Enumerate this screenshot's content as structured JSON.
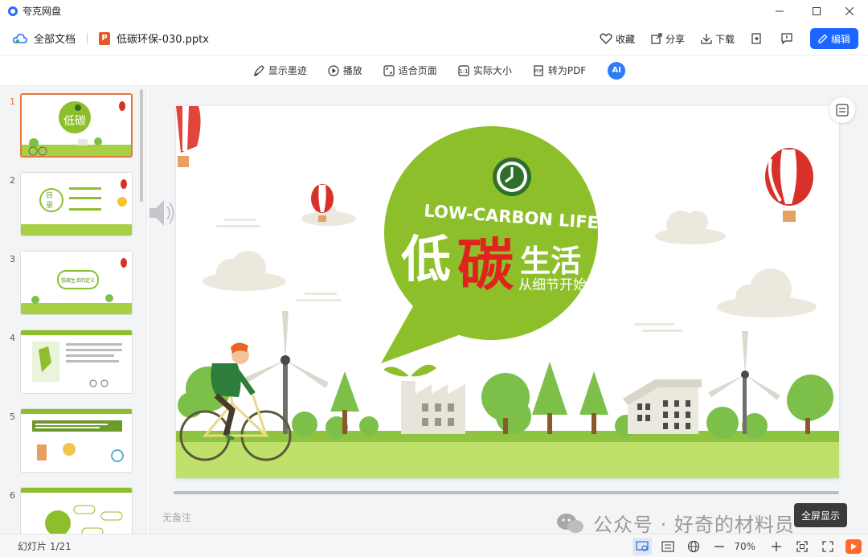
{
  "window": {
    "title": "夸克网盘",
    "controls": [
      "minimize-icon",
      "maximize-icon",
      "close-icon"
    ]
  },
  "docbar": {
    "all_docs": "全部文档",
    "file_name": "低碳环保-030.pptx",
    "file_badge": "P",
    "actions": {
      "favorite": "收藏",
      "share": "分享",
      "download": "下载"
    },
    "edit": "编辑"
  },
  "toolbar": {
    "ink": "显示墨迹",
    "play": "播放",
    "fit_page": "适合页面",
    "actual_size": "实际大小",
    "to_pdf": "转为PDF",
    "ai": "AI"
  },
  "sidebar": {
    "thumbnails": [
      {
        "num": "1"
      },
      {
        "num": "2"
      },
      {
        "num": "3"
      },
      {
        "num": "4"
      },
      {
        "num": "5"
      },
      {
        "num": "6"
      }
    ],
    "thumb_texts": {
      "t1": "低碳",
      "t2a": "目",
      "t2b": "录",
      "t3": "低碳生活的定义"
    }
  },
  "slide": {
    "headline_en": "LOW-CARBON LIFE",
    "char1": "低",
    "char2": "碳",
    "char34": "生活",
    "subtitle": "从细节开始",
    "colors": {
      "green": "#8dbf2a",
      "red": "#e0231c",
      "ground": "#a8d045"
    }
  },
  "main": {
    "notes": "无备注"
  },
  "overlay": {
    "watermark": "公众号 · 好奇的材料员",
    "tooltip": "全屏显示"
  },
  "status": {
    "slide_count": "幻灯片 1/21",
    "zoom": "70%"
  }
}
